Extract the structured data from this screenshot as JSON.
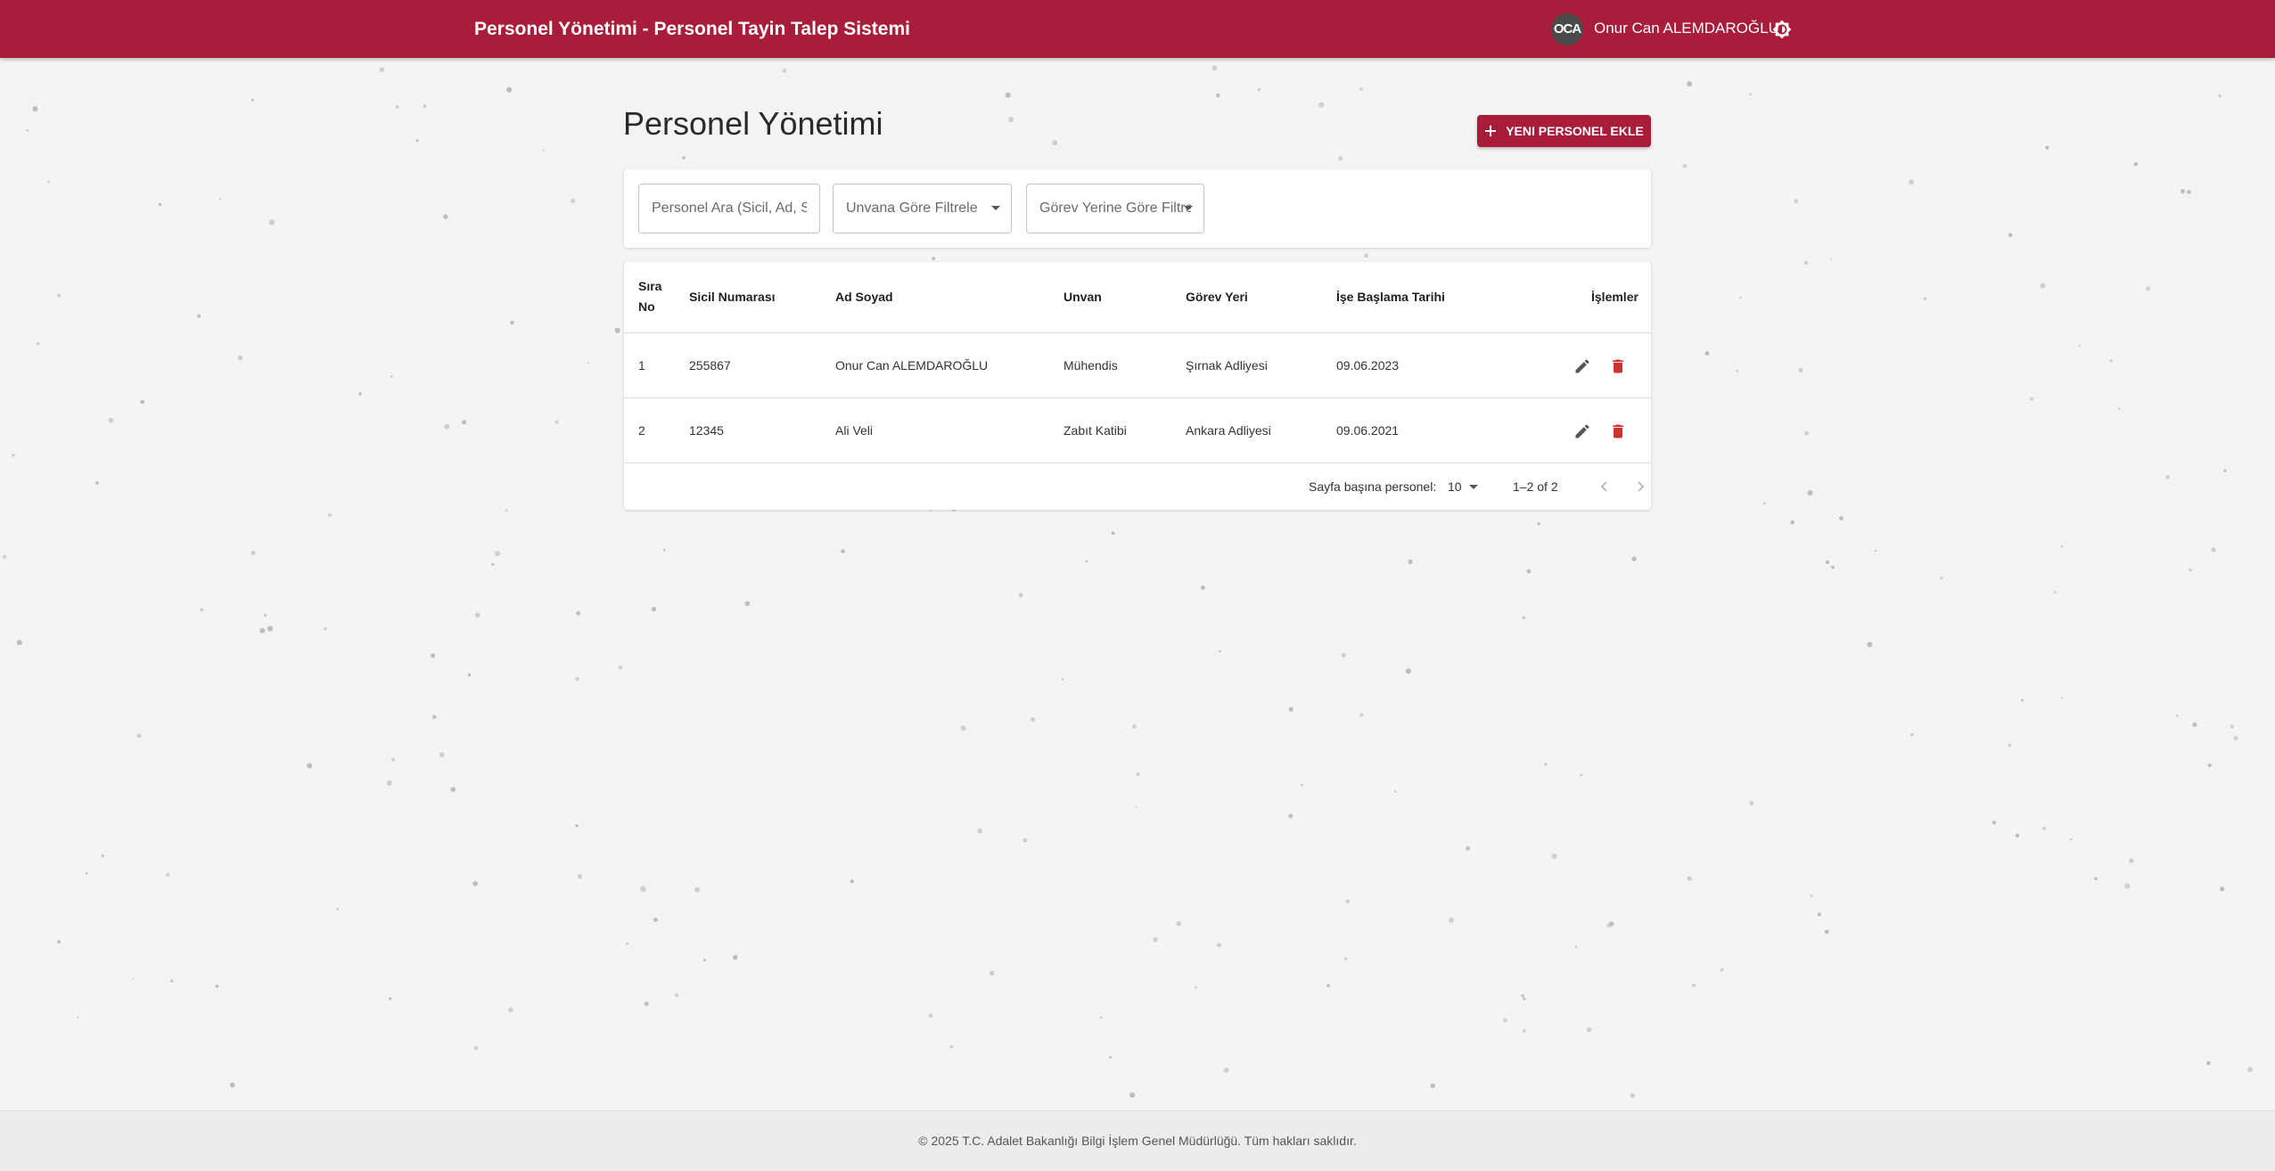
{
  "appbar": {
    "title": "Personel Yönetimi - Personel Tayin Talep Sistemi",
    "avatar_initials": "OCA",
    "username": "Onur Can ALEMDAROĞLU",
    "theme_icon": "brightness-icon",
    "color": "#a91c3a"
  },
  "page": {
    "title": "Personel Yönetimi",
    "add_button_label": "YENI PERSONEL EKLE",
    "add_icon": "plus-icon"
  },
  "filters": {
    "search_placeholder": "Personel Ara (Sicil, Ad, Soyad)",
    "title_filter": "Unvana Göre Filtrele",
    "location_filter": "Görev Yerine Göre Filtrele"
  },
  "table": {
    "headers": {
      "no_line1": "Sıra",
      "no_line2": "No",
      "sicil": "Sicil Numarası",
      "name": "Ad Soyad",
      "unvan": "Unvan",
      "gorev": "Görev Yeri",
      "start": "İşe Başlama Tarihi",
      "actions": "İşlemler"
    },
    "rows": [
      {
        "no": "1",
        "sicil": "255867",
        "name": "Onur Can ALEMDAROĞLU",
        "unvan": "Mühendis",
        "gorev": "Şırnak Adliyesi",
        "start": "09.06.2023"
      },
      {
        "no": "2",
        "sicil": "12345",
        "name": "Ali Veli",
        "unvan": "Zabıt Katibi",
        "gorev": "Ankara Adliyesi",
        "start": "09.06.2021"
      }
    ],
    "action_icons": [
      "edit-icon",
      "delete-icon"
    ],
    "delete_color": "#d32f2f"
  },
  "pagination": {
    "rows_per_page_label": "Sayfa başına personel:",
    "rows_per_page": "10",
    "range": "1–2 of 2"
  },
  "footer": {
    "text": "© 2025 T.C. Adalet Bakanlığı Bilgi İşlem Genel Müdürlüğü. Tüm hakları saklıdır."
  }
}
